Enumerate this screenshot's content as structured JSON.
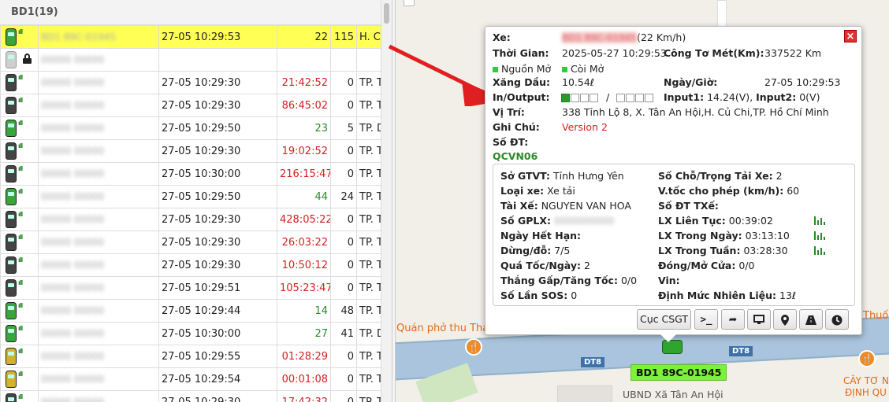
{
  "list": {
    "group_label": "BD1(19)",
    "rows": [
      {
        "icon": "green",
        "signal": true,
        "plate": "BD1 89C-01945",
        "time": "27-05 10:29:53",
        "duration": "22",
        "dur_color": "black",
        "speed": "115",
        "address": "H. Củ Chi",
        "selected": true
      },
      {
        "icon": "gray",
        "signal": false,
        "lock": true,
        "plate": "",
        "time": "",
        "duration": "",
        "dur_color": "black",
        "speed": "",
        "address": ""
      },
      {
        "icon": "dark",
        "signal": true,
        "plate": "",
        "time": "27-05 10:29:30",
        "duration": "21:42:52",
        "dur_color": "red",
        "speed": "0",
        "address": "TP. Thuận An"
      },
      {
        "icon": "dark",
        "signal": true,
        "plate": "",
        "time": "27-05 10:29:30",
        "duration": "86:45:02",
        "dur_color": "red",
        "speed": "0",
        "address": "TP. Thuận An"
      },
      {
        "icon": "green",
        "signal": true,
        "plate": "",
        "time": "27-05 10:29:50",
        "duration": "23",
        "dur_color": "green",
        "speed": "5",
        "address": "TP. Dĩ An"
      },
      {
        "icon": "dark",
        "signal": true,
        "plate": "",
        "time": "27-05 10:29:30",
        "duration": "19:02:52",
        "dur_color": "red",
        "speed": "0",
        "address": "TP. Thuận An"
      },
      {
        "icon": "dark",
        "signal": true,
        "plate": "",
        "time": "27-05 10:30:00",
        "duration": "216:15:47",
        "dur_color": "red",
        "speed": "0",
        "address": "TP. Thuận An"
      },
      {
        "icon": "green",
        "signal": true,
        "plate": "",
        "time": "27-05 10:29:50",
        "duration": "44",
        "dur_color": "green",
        "speed": "24",
        "address": "TP. Thuận An"
      },
      {
        "icon": "dark",
        "signal": true,
        "plate": "",
        "time": "27-05 10:29:30",
        "duration": "428:05:22",
        "dur_color": "red",
        "speed": "0",
        "address": "TP. Thủ Dầu"
      },
      {
        "icon": "dark",
        "signal": true,
        "plate": "",
        "time": "27-05 10:29:30",
        "duration": "26:03:22",
        "dur_color": "red",
        "speed": "0",
        "address": "TP. Thuận An"
      },
      {
        "icon": "dark",
        "signal": true,
        "plate": "",
        "time": "27-05 10:29:30",
        "duration": "10:50:12",
        "dur_color": "red",
        "speed": "0",
        "address": "TP. Tân Uyên"
      },
      {
        "icon": "dark",
        "signal": true,
        "plate": "",
        "time": "27-05 10:29:51",
        "duration": "105:23:47",
        "dur_color": "red",
        "speed": "0",
        "address": "TP. Thủ Dầu"
      },
      {
        "icon": "green",
        "signal": true,
        "plate": "",
        "time": "27-05 10:29:44",
        "duration": "14",
        "dur_color": "green",
        "speed": "48",
        "address": "TP. Thủ Đức"
      },
      {
        "icon": "green",
        "signal": true,
        "plate": "",
        "time": "27-05 10:30:00",
        "duration": "27",
        "dur_color": "green",
        "speed": "41",
        "address": "TP. Dĩ An"
      },
      {
        "icon": "yellow",
        "signal": true,
        "plate": "",
        "time": "27-05 10:29:55",
        "duration": "01:28:29",
        "dur_color": "red",
        "speed": "0",
        "address": "TP. Tân Uyên"
      },
      {
        "icon": "yellow",
        "signal": true,
        "plate": "",
        "time": "27-05 10:29:54",
        "duration": "00:01:08",
        "dur_color": "red",
        "speed": "0",
        "address": "TP. Thuận An"
      },
      {
        "icon": "dark",
        "signal": true,
        "plate": "",
        "time": "27-05 10:29:30",
        "duration": "17:42:32",
        "dur_color": "red",
        "speed": "0",
        "address": "TP. Thuận An"
      }
    ]
  },
  "popup": {
    "xe_label": "Xe:",
    "xe_speed": "(22 Km/h)",
    "thoigian_label": "Thời Gian:",
    "thoigian_value": "2025-05-27 10:29:53",
    "congtomet_label": "Công Tơ Mét(Km):",
    "congtomet_value": "337522 Km",
    "nguonmo": "Nguồn Mở",
    "coimo": "Còi Mở",
    "xangdau_label": "Xăng Dầu:",
    "xangdau_value": "10.54ℓ",
    "ngaygio_label": "Ngày/Giờ:",
    "ngaygio_value": "27-05 10:29:53",
    "inout_label": "In/Output:",
    "inout_sep": "/",
    "input1_label": "Input1:",
    "input1_value": "14.24(V),",
    "input2_label": "Input2:",
    "input2_value": "0(V)",
    "vitri_label": "Vị Trí:",
    "vitri_value": "338 Tỉnh Lộ 8, X. Tân An Hội,H. Củ Chi,TP. Hồ Chí Minh",
    "ghichu_label": "Ghi Chú:",
    "ghichu_value": "Version 2",
    "sodt_label": "Số ĐT:",
    "qcvn": "QCVN06",
    "sogtvt_label": "Sở GTVT:",
    "sogtvt_value": "Tỉnh Hưng Yên",
    "socho_label": "Số Chỗ/Trọng Tải Xe:",
    "socho_value": "2",
    "loaixe_label": "Loại xe:",
    "loaixe_value": "Xe tải",
    "vtoc_label": "V.tốc cho phép (km/h):",
    "vtoc_value": "60",
    "taixe_label": "Tài Xế:",
    "taixe_value": "NGUYEN VAN HOA",
    "sodttxe_label": "Số ĐT TXế:",
    "sogplx_label": "Số GPLX:",
    "lxlientuc_label": "LX Liên Tục:",
    "lxlientuc_value": "00:39:02",
    "ngayhethan_label": "Ngày Hết Hạn:",
    "lxtrongngay_label": "LX Trong Ngày:",
    "lxtrongngay_value": "03:13:10",
    "dungdo_label": "Dừng/đỗ:",
    "dungdo_value": "7/5",
    "lxtrongtuan_label": "LX Trong Tuần:",
    "lxtrongtuan_value": "03:28:30",
    "quatoc_label": "Quá Tốc/Ngày:",
    "quatoc_value": "2",
    "dongmo_label": "Đóng/Mở Cửa:",
    "dongmo_value": "0/0",
    "thanggap_label": "Thắng Gấp/Tăng Tốc:",
    "thanggap_value": "0/0",
    "vin_label": "Vin:",
    "solansos_label": "Số Lần SOS:",
    "solansos_value": "0",
    "dinhmuc_label": "Định Mức Nhiên Liệu:",
    "dinhmuc_value": "13ℓ",
    "close": "×",
    "cuccsgt": "Cục CSGT"
  },
  "map": {
    "plate_label": "BD1 89C-01945",
    "road_dt8_a": "DT8",
    "road_dt8_b": "DT8",
    "poi_pho": "Quán phở thu Thảo",
    "poi_thuoc": "Thuốc",
    "poi_cay_1": "CÂY TƠ N",
    "poi_cay_2": "ĐỊNH QU",
    "ubnd": "UBND Xã Tân An Hội"
  }
}
